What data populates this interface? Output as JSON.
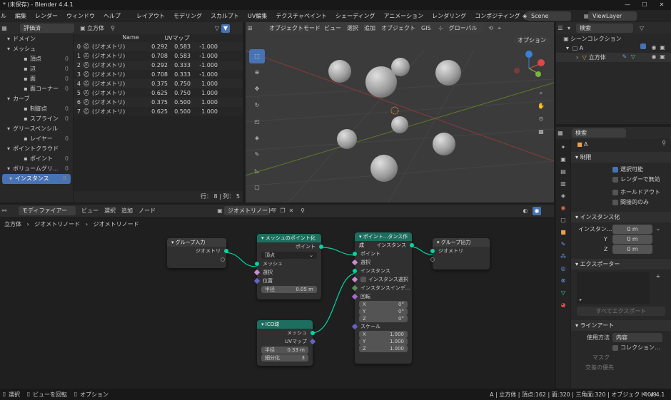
{
  "window": {
    "title": "* (未保存) - Blender 4.4.1",
    "min": "—",
    "max": "☐",
    "close": "✕"
  },
  "menu": {
    "items": [
      "ル",
      "編集",
      "レンダー",
      "ウィンドウ",
      "ヘルプ"
    ],
    "workspaces": [
      "レイアウト",
      "モデリング",
      "スカルプト",
      "UV編集",
      "テクスチャペイント",
      "シェーディング",
      "アニメーション",
      "レンダリング",
      "コンポジティング",
      "ジオメト"
    ],
    "active_ws": 9,
    "scene": "Scene",
    "viewlayer": "ViewLayer"
  },
  "spreadsheet": {
    "mode": "評価済",
    "object": "立方体",
    "tree": [
      {
        "label": "ドメイン",
        "level": 0,
        "count": ""
      },
      {
        "label": "メッシュ",
        "level": 0,
        "count": ""
      },
      {
        "label": "頂点",
        "level": 1,
        "count": "0"
      },
      {
        "label": "辺",
        "level": 1,
        "count": "0"
      },
      {
        "label": "面",
        "level": 1,
        "count": "0"
      },
      {
        "label": "面コーナー",
        "level": 1,
        "count": "0"
      },
      {
        "label": "カーブ",
        "level": 0,
        "count": ""
      },
      {
        "label": "制御点",
        "level": 1,
        "count": "0"
      },
      {
        "label": "スプライン",
        "level": 1,
        "count": "0"
      },
      {
        "label": "グリースペンシル",
        "level": 0,
        "count": ""
      },
      {
        "label": "レイヤー",
        "level": 1,
        "count": "0"
      },
      {
        "label": "ポイントクラウド",
        "level": 0,
        "count": ""
      },
      {
        "label": "ポイント",
        "level": 1,
        "count": "0"
      },
      {
        "label": "ボリュームグリ...",
        "level": 0,
        "count": "0"
      },
      {
        "label": "インスタンス",
        "level": 0,
        "count": "8"
      }
    ],
    "columns": [
      "Name",
      "UVマップ"
    ],
    "rows": [
      {
        "i": "0",
        "name": "(ジオメトリ)",
        "u": "0.292",
        "v": "0.583",
        "w": "-1.000"
      },
      {
        "i": "1",
        "name": "(ジオメトリ)",
        "u": "0.708",
        "v": "0.583",
        "w": "-1.000"
      },
      {
        "i": "2",
        "name": "(ジオメトリ)",
        "u": "0.292",
        "v": "0.333",
        "w": "-1.000"
      },
      {
        "i": "3",
        "name": "(ジオメトリ)",
        "u": "0.708",
        "v": "0.333",
        "w": "-1.000"
      },
      {
        "i": "4",
        "name": "(ジオメトリ)",
        "u": "0.375",
        "v": "0.750",
        "w": "1.000"
      },
      {
        "i": "5",
        "name": "(ジオメトリ)",
        "u": "0.625",
        "v": "0.750",
        "w": "1.000"
      },
      {
        "i": "6",
        "name": "(ジオメトリ)",
        "u": "0.375",
        "v": "0.500",
        "w": "1.000"
      },
      {
        "i": "7",
        "name": "(ジオメトリ)",
        "u": "0.625",
        "v": "0.500",
        "w": "1.000"
      }
    ],
    "footer": "行： 8 | 列： 5"
  },
  "viewport": {
    "mode": "オブジェクトモード",
    "menus": [
      "ビュー",
      "選択",
      "追加",
      "オブジェクト",
      "GIS"
    ],
    "orientation": "グローバル",
    "options": "オプション"
  },
  "outliner": {
    "search": "検索",
    "root": "シーンコレクション",
    "collection": "A",
    "object": "立方体"
  },
  "node_editor": {
    "editor": "モディファイアー",
    "menus": [
      "ビュー",
      "選択",
      "追加",
      "ノード"
    ],
    "tree": "ジオメトリノード",
    "breadcrumb": [
      "立方体",
      "ジオメトリノード",
      "ジオメトリノード"
    ],
    "group_in": {
      "title": "グループ入力",
      "out": "ジオメトリ"
    },
    "mesh_to_points": {
      "title": "メッシュのポイント化",
      "out": "ポイント",
      "mode": "頂点",
      "inputs": [
        "メッシュ",
        "選択",
        "位置"
      ],
      "radius_label": "半径",
      "radius": "0.05 m"
    },
    "ico": {
      "title": "ICO球",
      "outs": [
        "メッシュ",
        "UVマップ"
      ],
      "radius_label": "半径",
      "radius": "0.33 m",
      "sub_label": "細分化",
      "sub": "3"
    },
    "instance": {
      "title": "ポイント...タンス作成",
      "out": "インスタンス",
      "inputs": [
        "ポイント",
        "選択",
        "インスタンス"
      ],
      "select_inst": "インスタンス選択",
      "inst_index": "インスタンスインデ...",
      "rotation": "回転",
      "rot": [
        [
          "X",
          "0°"
        ],
        [
          "Y",
          "0°"
        ],
        [
          "Z",
          "0°"
        ]
      ],
      "scale": "スケール",
      "scl": [
        [
          "X",
          "1.000"
        ],
        [
          "Y",
          "1.000"
        ],
        [
          "Z",
          "1.000"
        ]
      ]
    },
    "group_out": {
      "title": "グループ出力",
      "in": "ジオメトリ"
    }
  },
  "properties": {
    "search": "検索",
    "object": "A",
    "visibility": {
      "title": "制限",
      "items": [
        {
          "label": "選択可能",
          "on": true
        },
        {
          "label": "レンダーで無効",
          "on": false
        },
        {
          "label": "ホールドアウト",
          "on": false
        },
        {
          "label": "間接的のみ",
          "on": false
        }
      ]
    },
    "instancing": {
      "title": "インスタンス化",
      "offset_label": "インスタン...",
      "x": "0 m",
      "y_label": "Y",
      "y": "0 m",
      "z_label": "Z",
      "z": "0 m"
    },
    "exporter": {
      "title": "エクスポーター",
      "export_all": "すべてエクスポート"
    },
    "lineart": {
      "title": "ラインアート",
      "usage_label": "使用方法",
      "usage": "内容",
      "collection": "コレクション...",
      "mask": "マスク",
      "partial": "交差の優先"
    }
  },
  "status": {
    "left": [
      "選択",
      "ビューを回転",
      "オプション"
    ],
    "right": "A | 立方体 | 頂点:162 | 面:320 | 三角面:320 | オブジェクト:0/9",
    "version": "4.4.1"
  }
}
